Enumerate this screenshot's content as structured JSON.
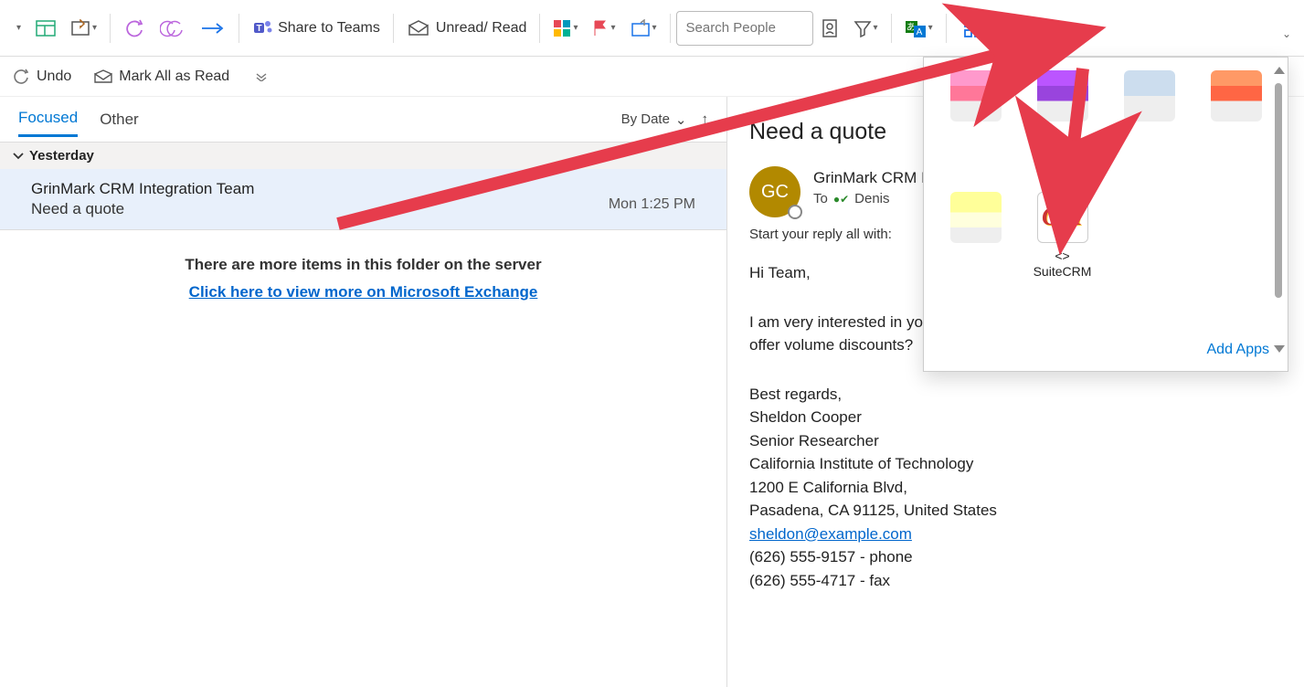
{
  "toolbar": {
    "share_teams": "Share to Teams",
    "unread_read": "Unread/ Read",
    "search_placeholder": "Search People"
  },
  "bar2": {
    "undo": "Undo",
    "mark_all": "Mark All as Read"
  },
  "tabs": {
    "focused": "Focused",
    "other": "Other",
    "sort_label": "By Date"
  },
  "list": {
    "group1": "Yesterday",
    "item1": {
      "from": "GrinMark CRM Integration Team",
      "subject": "Need a quote",
      "date": "Mon 1:25 PM"
    },
    "folder_msg": "There are more items in this folder on the server",
    "view_more": "Click here to view more on Microsoft Exchange"
  },
  "reading": {
    "subject": "Need a quote",
    "avatar_initials": "GC",
    "from": "GrinMark CRM Integration Team",
    "to_label": "To",
    "to_name": "Denis",
    "suggest": "Start your reply all with:",
    "body_greeting": "Hi Team,",
    "body_line1": "I am very interested in your product. Could you provide me the price? Do you offer volume discounts?",
    "sig_regards": "Best regards,",
    "sig_name": "Sheldon Cooper",
    "sig_title": "Senior Researcher",
    "sig_org": "California Institute of Technology",
    "sig_addr1": "1200 E California Blvd,",
    "sig_addr2": "Pasadena, CA 91125, United States",
    "sig_email": "sheldon@example.com",
    "sig_phone": "(626) 555-9157 - phone",
    "sig_fax": "(626) 555-4717 - fax"
  },
  "addins": {
    "app6_line1": "<>",
    "app6_line2": "SuiteCRM",
    "add_apps": "Add Apps"
  }
}
